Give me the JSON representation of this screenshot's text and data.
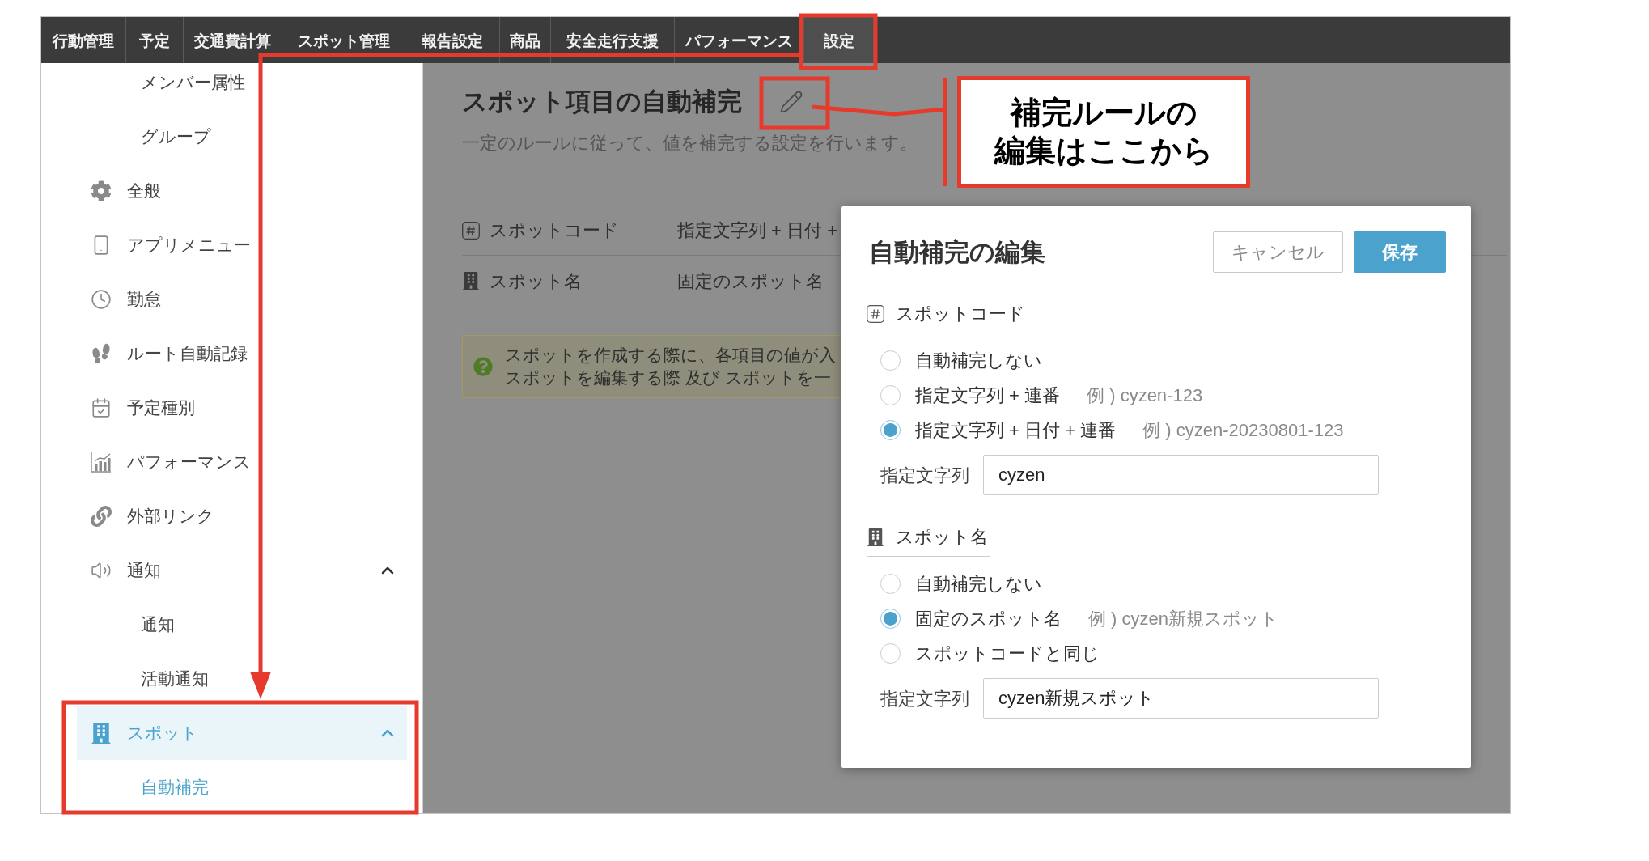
{
  "nav": {
    "tabs": [
      {
        "label": "行動管理",
        "selected": false
      },
      {
        "label": "予定",
        "selected": false
      },
      {
        "label": "交通費計算",
        "selected": false
      },
      {
        "label": "スポット管理",
        "selected": false
      },
      {
        "label": "報告設定",
        "selected": false
      },
      {
        "label": "商品",
        "selected": false
      },
      {
        "label": "安全走行支援",
        "selected": false
      },
      {
        "label": "パフォーマンス",
        "selected": false
      },
      {
        "label": "設定",
        "selected": true
      }
    ]
  },
  "sidebar": {
    "items": [
      {
        "children": [
          {
            "label": "メンバー属性",
            "selected": false
          },
          {
            "label": "グループ",
            "selected": false
          }
        ]
      },
      {
        "label": "全般",
        "selected": false
      },
      {
        "label": "アプリメニュー",
        "selected": false
      },
      {
        "label": "勤怠",
        "selected": false
      },
      {
        "label": "ルート自動記録",
        "selected": false
      },
      {
        "label": "予定種別",
        "selected": false
      },
      {
        "label": "パフォーマンス",
        "selected": false
      },
      {
        "label": "外部リンク",
        "selected": false
      },
      {
        "label": "通知",
        "selected": false,
        "expanded": true,
        "children": [
          {
            "label": "通知",
            "selected": false
          },
          {
            "label": "活動通知",
            "selected": false
          }
        ]
      },
      {
        "label": "スポット",
        "selected": true,
        "expanded": true,
        "children": [
          {
            "label": "自動補完",
            "selected": true
          }
        ]
      }
    ]
  },
  "page": {
    "title": "スポット項目の自動補完",
    "description": "一定のルールに従って、値を補完する設定を行います。",
    "rules": [
      {
        "kind": "code",
        "label": "スポットコード",
        "value": "指定文字列 + 日付 +"
      },
      {
        "kind": "name",
        "label": "スポット名",
        "value": "固定のスポット名"
      }
    ],
    "notice": {
      "lines": [
        "スポットを作成する際に、各項目の値が入",
        "スポットを編集する際 及び スポットを一"
      ]
    }
  },
  "dialog": {
    "title": "自動補完の編集",
    "buttons": [
      {
        "kind": "secondary",
        "label": "キャンセル"
      },
      {
        "kind": "primary",
        "label": "保存"
      }
    ],
    "sections": [
      {
        "kind": "code",
        "heading": "スポットコード",
        "options": [
          {
            "label": "自動補完しない",
            "selected": false
          },
          {
            "label": "指定文字列 + 連番",
            "example": "例 ) cyzen-123",
            "selected": false
          },
          {
            "label": "指定文字列 + 日付 + 連番",
            "example": "例 ) cyzen-20230801-123",
            "selected": true
          }
        ],
        "field": {
          "label": "指定文字列",
          "value": "cyzen"
        }
      },
      {
        "kind": "name",
        "heading": "スポット名",
        "options": [
          {
            "label": "自動補完しない",
            "selected": false
          },
          {
            "label": "固定のスポット名",
            "example": "例 ) cyzen新規スポット",
            "selected": true
          },
          {
            "label": "スポットコードと同じ",
            "selected": false
          }
        ],
        "field": {
          "label": "指定文字列",
          "value": "cyzen新規スポット"
        }
      }
    ]
  },
  "callout": {
    "lines": [
      "補完ルールの",
      "編集はここから"
    ]
  }
}
